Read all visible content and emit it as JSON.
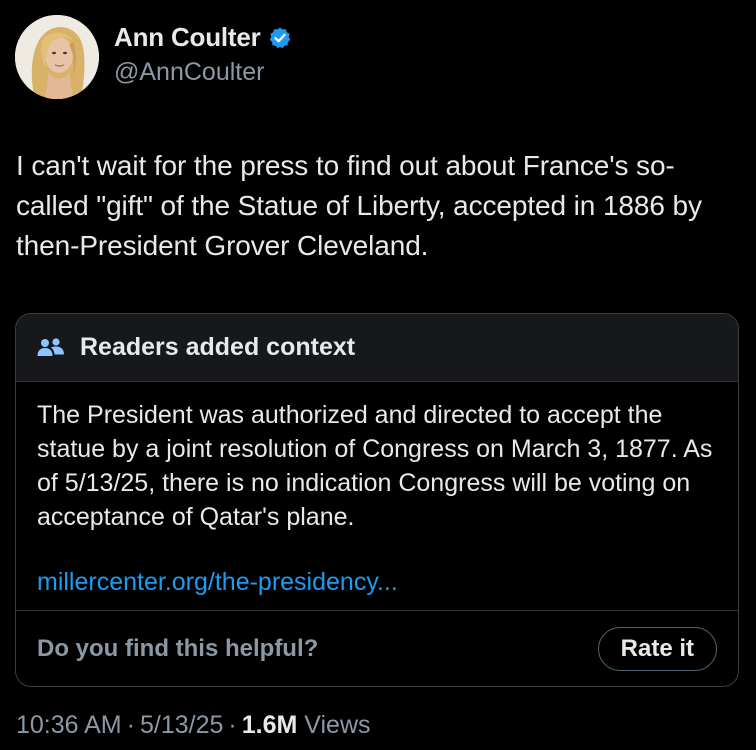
{
  "author": {
    "display_name": "Ann Coulter",
    "handle": "@AnnCoulter",
    "verified": true,
    "verified_color": "#1d9bf0"
  },
  "tweet": {
    "text": "I can't wait for the press to find out about France's so-called \"gift\" of the Statue of Liberty, accepted in 1886 by then-President Grover Cleveland."
  },
  "community_note": {
    "title": "Readers added context",
    "icon": "people-icon",
    "body": "The President was authorized and directed to accept the statue by a joint resolution of Congress on March 3, 1877. As of 5/13/25, there is no indication Congress will be voting on acceptance of Qatar's plane.",
    "link_text": "millercenter.org/the-presidency...",
    "helpful_question": "Do you find this helpful?",
    "rate_button_label": "Rate it"
  },
  "meta": {
    "time": "10:36 AM",
    "date": "5/13/25",
    "separator": "·",
    "views_count": "1.6M",
    "views_label": "Views"
  },
  "colors": {
    "background": "#000000",
    "text_primary": "#e7e9ea",
    "text_secondary": "#8b98a5",
    "link": "#1d9bf0",
    "note_header_bg": "#16181c",
    "border": "#2f3336"
  }
}
